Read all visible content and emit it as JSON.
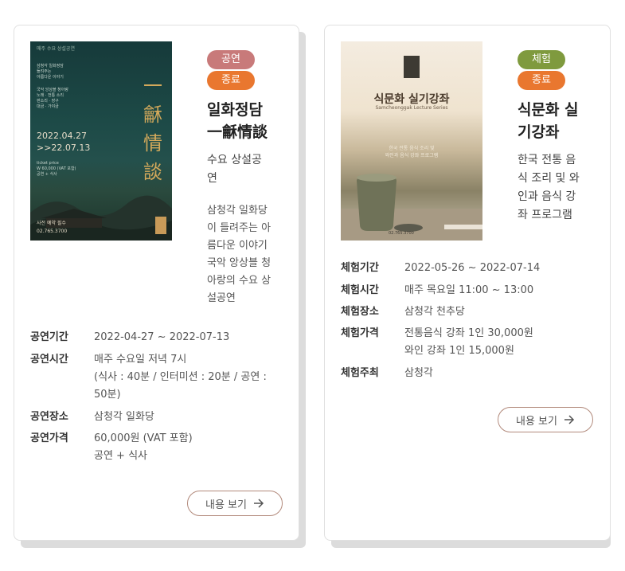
{
  "cards": [
    {
      "badges": [
        {
          "label": "공연",
          "color": "#c87a7a"
        },
        {
          "label": "종료",
          "color": "#e9772f"
        }
      ],
      "title": "일화정담\n一龢情談",
      "title_line1": "일화정담",
      "title_line2": "一龢情談",
      "subtitle_line1": "수요 상설공",
      "subtitle_line2": "연",
      "desc_lines": [
        "삼청각 일화당",
        "이 들려주는 아",
        "름다운 이야기",
        "국악 앙상블 청",
        "아랑의 수요 상",
        "설공연"
      ],
      "poster": {
        "top_text": "매주 수요 상설공연",
        "hanzi": "一龢情談",
        "date_start": "2022.04.27",
        "date_end": ">>22.07.13",
        "phone": "02.765.3700"
      },
      "info": [
        {
          "label": "공연기간",
          "values": [
            "2022-04-27 ~ 2022-07-13"
          ]
        },
        {
          "label": "공연시간",
          "values": [
            "매주 수요일 저녁 7시",
            "(식사 : 40분 / 인터미션 : 20분 / 공연 :",
            "50분)"
          ]
        },
        {
          "label": "공연장소",
          "values": [
            "삼청각 일화당"
          ]
        },
        {
          "label": "공연가격",
          "values": [
            "60,000원 (VAT 포함)",
            "공연 + 식사"
          ]
        }
      ],
      "more_label": "내용 보기"
    },
    {
      "badges": [
        {
          "label": "체험",
          "color": "#7f9a3e"
        },
        {
          "label": "종료",
          "color": "#e9772f"
        }
      ],
      "title_line1": "식문화 실",
      "title_line2": "기강좌",
      "subtitle_lines": [
        "한국 전통 음",
        "식 조리 및 와",
        "인과 음식 강",
        "좌 프로그램"
      ],
      "poster": {
        "title": "식문화 실기강좌",
        "sub": "Samcheonggak Lecture Series",
        "phone": "02.765.3700"
      },
      "info": [
        {
          "label": "체험기간",
          "values": [
            "2022-05-26 ~ 2022-07-14"
          ]
        },
        {
          "label": "체험시간",
          "values": [
            "매주 목요일 11:00 ~ 13:00"
          ]
        },
        {
          "label": "체험장소",
          "values": [
            "삼청각 천추당"
          ]
        },
        {
          "label": "체험가격",
          "values": [
            "전통음식 강좌 1인 30,000원",
            "와인 강좌 1인 15,000원"
          ]
        },
        {
          "label": "체험주최",
          "values": [
            "삼청각"
          ]
        }
      ],
      "more_label": "내용 보기"
    }
  ]
}
